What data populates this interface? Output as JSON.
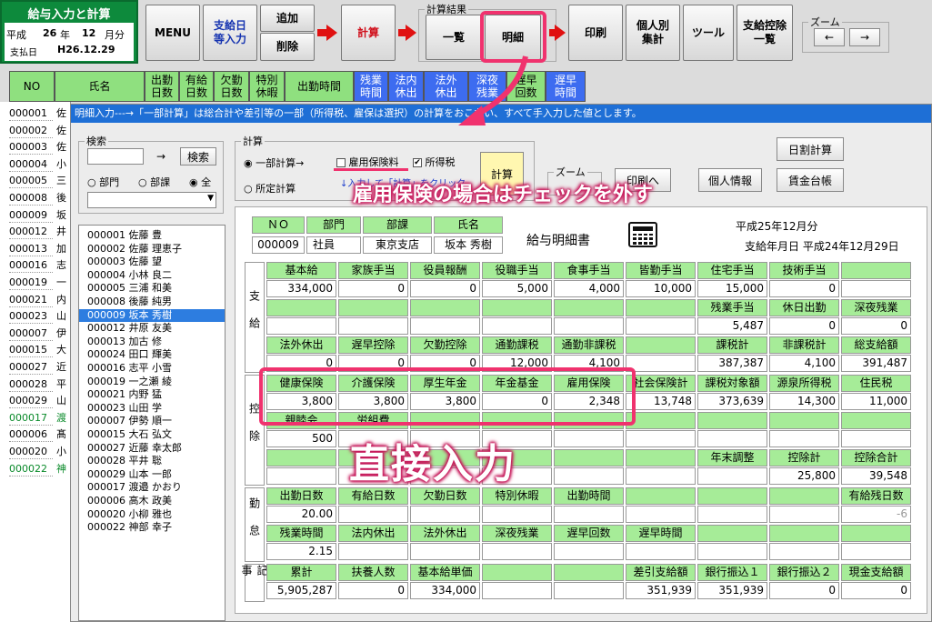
{
  "title_box": {
    "title": "給与入力と計算",
    "era": "平成",
    "year": "26",
    "year_unit": "年",
    "month": "12",
    "month_unit": "月分",
    "paid_label": "支払日",
    "paid_date": "H26.12.29"
  },
  "toolbar": {
    "menu": "MENU",
    "payday_entry": "支給日\n等入力",
    "add": "追加",
    "delete": "削除",
    "calc": "計算",
    "results_label": "計算結果",
    "list": "一覧",
    "detail": "明細",
    "print": "印刷",
    "per_person": "個人別\n集計",
    "tools": "ツール",
    "pay_deduction_list": "支給控除\n一覧",
    "zoom_label": "ズーム",
    "zoom_left": "←",
    "zoom_right": "→"
  },
  "grid_headers": [
    {
      "label": "NO",
      "blue": false
    },
    {
      "label": "氏名",
      "blue": false
    },
    {
      "label": "出勤\n日数",
      "blue": false
    },
    {
      "label": "有給\n日数",
      "blue": false
    },
    {
      "label": "欠勤\n日数",
      "blue": false
    },
    {
      "label": "特別\n休暇",
      "blue": false
    },
    {
      "label": "出勤時間",
      "blue": false
    },
    {
      "label": "残業\n時間",
      "blue": true
    },
    {
      "label": "法内\n休出",
      "blue": true
    },
    {
      "label": "法外\n休出",
      "blue": true
    },
    {
      "label": "深夜\n残業",
      "blue": true
    },
    {
      "label": "遅早\n回数",
      "blue": false
    },
    {
      "label": "遅早\n時間",
      "blue": true
    }
  ],
  "grid_rows": [
    {
      "no": "000001",
      "name": "佐"
    },
    {
      "no": "000002",
      "name": "佐"
    },
    {
      "no": "000003",
      "name": "佐"
    },
    {
      "no": "000004",
      "name": "小"
    },
    {
      "no": "000005",
      "name": "三"
    },
    {
      "no": "000008",
      "name": "後"
    },
    {
      "no": "000009",
      "name": "坂"
    },
    {
      "no": "000012",
      "name": "井"
    },
    {
      "no": "000013",
      "name": "加"
    },
    {
      "no": "000016",
      "name": "志"
    },
    {
      "no": "000019",
      "name": "一"
    },
    {
      "no": "000021",
      "name": "内"
    },
    {
      "no": "000023",
      "name": "山"
    },
    {
      "no": "000007",
      "name": "伊"
    },
    {
      "no": "000015",
      "name": "大"
    },
    {
      "no": "000027",
      "name": "近"
    },
    {
      "no": "000028",
      "name": "平"
    },
    {
      "no": "000029",
      "name": "山"
    },
    {
      "no": "000017",
      "name": "渡"
    },
    {
      "no": "000006",
      "name": "髙"
    },
    {
      "no": "000020",
      "name": "小"
    },
    {
      "no": "000022",
      "name": "神"
    }
  ],
  "dialog": {
    "title": "明細入力---→「一部計算」は総合計や差引等の一部（所得税、雇保は選択）の計算をおこない、すべて手入力した値とします。",
    "search_label": "検索",
    "search_button": "検索",
    "search_arrow": "→",
    "radio_dept": "部門",
    "radio_section": "部課",
    "radio_all": "全",
    "calc_label": "計算",
    "partial_calc": "一部計算→",
    "fixed_calc": "所定計算",
    "chk_employment_ins": "雇用保険料",
    "chk_income_tax": "所得税",
    "calc_hint": "↓入力して「計算」をクリック",
    "calc_button": "計算",
    "zoom_label": "ズーム",
    "print_preview": "印刷へ",
    "personal_info": "個人情報",
    "daily_calc": "日割計算",
    "wage_ledger": "賃金台帳"
  },
  "employees": [
    "000001 佐藤 豊",
    "000002 佐藤 理恵子",
    "000003 佐藤 望",
    "000004 小林 良二",
    "000005 三浦 和美",
    "000008 後藤 純男",
    "000009 坂本 秀樹",
    "000012 井原 友美",
    "000013 加古 修",
    "000024 田口 輝美",
    "000016 志平 小雪",
    "000019 一之瀬 綾",
    "000021 内野 猛",
    "000023 山田 学",
    "000007 伊勢 順一",
    "000015 大石 弘文",
    "000027 近藤 幸太郎",
    "000028 平井 聡",
    "000029 山本 一郎",
    "000017 渡邉 かおり",
    "000006 高木 政美",
    "000020 小柳 雅也",
    "000022 神部 幸子"
  ],
  "selected_employee_index": 6,
  "slip": {
    "hdr_no": "ＮＯ",
    "hdr_dept": "部門",
    "hdr_section": "部課",
    "hdr_name": "氏名",
    "val_no": "000009",
    "val_dept": "社員",
    "val_section": "東京支店",
    "val_name": "坂本 秀樹",
    "title": "給与明細書",
    "period": "平成25年12月分",
    "paydate": "支給年月日 平成24年12月29日",
    "sec_pay": "支給",
    "sec_deduct": "控除",
    "sec_attend": "勤怠",
    "sec_record": "記事"
  },
  "pay_rows": [
    [
      {
        "h": "基本給",
        "v": "334,000"
      },
      {
        "h": "家族手当",
        "v": "0"
      },
      {
        "h": "役員報酬",
        "v": "0"
      },
      {
        "h": "役職手当",
        "v": "5,000"
      },
      {
        "h": "食事手当",
        "v": "4,000"
      },
      {
        "h": "皆勤手当",
        "v": "10,000"
      },
      {
        "h": "住宅手当",
        "v": "15,000"
      },
      {
        "h": "技術手当",
        "v": "0"
      },
      {
        "h": "",
        "v": ""
      }
    ],
    [
      {
        "h": "",
        "v": ""
      },
      {
        "h": "",
        "v": ""
      },
      {
        "h": "",
        "v": ""
      },
      {
        "h": "",
        "v": ""
      },
      {
        "h": "",
        "v": ""
      },
      {
        "h": "",
        "v": ""
      },
      {
        "h": "残業手当",
        "v": "5,487"
      },
      {
        "h": "休日出勤",
        "v": "0"
      },
      {
        "h": "深夜残業",
        "v": "0"
      }
    ],
    [
      {
        "h": "法外休出",
        "v": "0"
      },
      {
        "h": "遅早控除",
        "v": "0"
      },
      {
        "h": "欠勤控除",
        "v": "0"
      },
      {
        "h": "通勤課税",
        "v": "12,000"
      },
      {
        "h": "通勤非課税",
        "v": "4,100"
      },
      {
        "h": "",
        "v": ""
      },
      {
        "h": "課税計",
        "v": "387,387"
      },
      {
        "h": "非課税計",
        "v": "4,100"
      },
      {
        "h": "総支給額",
        "v": "391,487"
      }
    ]
  ],
  "deduct_rows": [
    [
      {
        "h": "健康保険",
        "v": "3,800"
      },
      {
        "h": "介護保険",
        "v": "3,800"
      },
      {
        "h": "厚生年金",
        "v": "3,800"
      },
      {
        "h": "年金基金",
        "v": "0"
      },
      {
        "h": "雇用保険",
        "v": "2,348"
      },
      {
        "h": "社会保険計",
        "v": "13,748"
      },
      {
        "h": "課税対象額",
        "v": "373,639"
      },
      {
        "h": "源泉所得税",
        "v": "14,300"
      },
      {
        "h": "住民税",
        "v": "11,000"
      }
    ],
    [
      {
        "h": "親睦会",
        "v": "500"
      },
      {
        "h": "労組費",
        "v": ""
      },
      {
        "h": "",
        "v": ""
      },
      {
        "h": "",
        "v": ""
      },
      {
        "h": "",
        "v": ""
      },
      {
        "h": "",
        "v": ""
      },
      {
        "h": "",
        "v": ""
      },
      {
        "h": "",
        "v": ""
      },
      {
        "h": "",
        "v": ""
      }
    ],
    [
      {
        "h": "",
        "v": ""
      },
      {
        "h": "",
        "v": ""
      },
      {
        "h": "",
        "v": ""
      },
      {
        "h": "",
        "v": ""
      },
      {
        "h": "",
        "v": ""
      },
      {
        "h": "",
        "v": ""
      },
      {
        "h": "年末調整",
        "v": ""
      },
      {
        "h": "控除計",
        "v": "25,800"
      },
      {
        "h": "控除合計",
        "v": "39,548"
      }
    ]
  ],
  "attend_rows": [
    [
      {
        "h": "出勤日数",
        "v": "20.00"
      },
      {
        "h": "有給日数",
        "v": ""
      },
      {
        "h": "欠勤日数",
        "v": ""
      },
      {
        "h": "特別休暇",
        "v": ""
      },
      {
        "h": "出勤時間",
        "v": ""
      },
      {
        "h": "",
        "v": ""
      },
      {
        "h": "",
        "v": ""
      },
      {
        "h": "",
        "v": ""
      },
      {
        "h": "有給残日数",
        "v": "-6"
      }
    ],
    [
      {
        "h": "残業時間",
        "v": "2.15"
      },
      {
        "h": "法内休出",
        "v": ""
      },
      {
        "h": "法外休出",
        "v": ""
      },
      {
        "h": "深夜残業",
        "v": ""
      },
      {
        "h": "遅早回数",
        "v": ""
      },
      {
        "h": "遅早時間",
        "v": ""
      },
      {
        "h": "",
        "v": ""
      },
      {
        "h": "",
        "v": ""
      },
      {
        "h": "",
        "v": ""
      }
    ]
  ],
  "record_row": [
    {
      "h": "累計",
      "v": "5,905,287"
    },
    {
      "h": "扶養人数",
      "v": "0"
    },
    {
      "h": "基本給単価",
      "v": "334,000"
    },
    {
      "h": "",
      "v": ""
    },
    {
      "h": "",
      "v": ""
    },
    {
      "h": "差引支給額",
      "v": "351,939"
    },
    {
      "h": "銀行振込１",
      "v": "351,939"
    },
    {
      "h": "銀行振込２",
      "v": "0"
    },
    {
      "h": "現金支給額",
      "v": "0"
    }
  ],
  "annotations": {
    "uncheck_note": "雇用保険の場合はチェックを外す",
    "direct_input": "直接入力"
  }
}
